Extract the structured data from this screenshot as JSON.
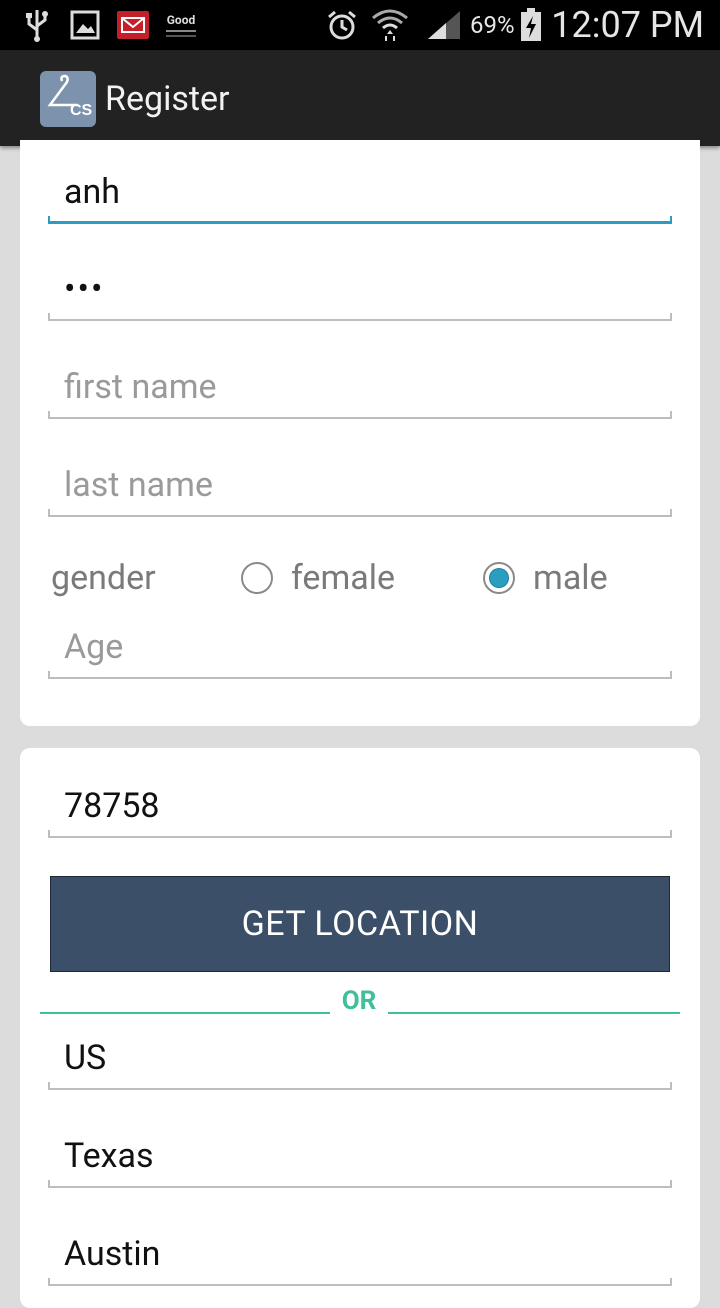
{
  "status_bar": {
    "battery_percent": "69%",
    "time": "12:07 PM",
    "notification_text": "Good",
    "icons": [
      "usb-icon",
      "image-icon",
      "mail-icon",
      "good-app-icon",
      "alarm-icon",
      "wifi-icon",
      "signal-icon",
      "battery-charging-icon"
    ]
  },
  "action_bar": {
    "app_icon_text": "CS",
    "title": "Register"
  },
  "form": {
    "username": {
      "value": "anh",
      "placeholder": ""
    },
    "password": {
      "value": "•••",
      "placeholder": ""
    },
    "first_name": {
      "value": "",
      "placeholder": "first name"
    },
    "last_name": {
      "value": "",
      "placeholder": "last name"
    },
    "gender": {
      "label": "gender",
      "options": [
        "female",
        "male"
      ],
      "selected": "male"
    },
    "age": {
      "value": "",
      "placeholder": "Age"
    }
  },
  "location": {
    "zip": {
      "value": "78758"
    },
    "get_location_label": "GET LOCATION",
    "or_label": "OR",
    "country": {
      "value": "US"
    },
    "state": {
      "value": "Texas"
    },
    "city": {
      "value": "Austin"
    }
  },
  "colors": {
    "accent": "#2a9ec0",
    "button": "#3b5068",
    "divider": "#3fbf9a",
    "action_bar": "#222222"
  }
}
